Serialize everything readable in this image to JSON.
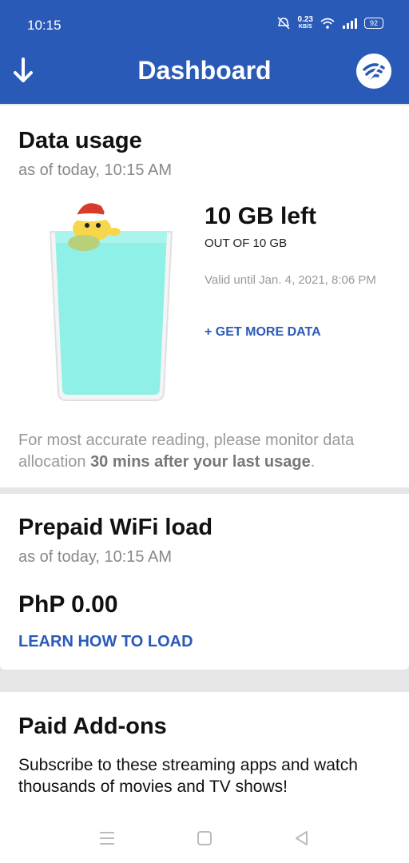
{
  "status_bar": {
    "time": "10:15",
    "net_speed_value": "0.23",
    "net_speed_unit": "KB/S",
    "battery": "92"
  },
  "header": {
    "title": "Dashboard",
    "background_color": "#2a5ab8"
  },
  "data_usage": {
    "title": "Data usage",
    "as_of": "as of today, 10:15 AM",
    "remaining": "10 GB left",
    "out_of": "OUT OF 10 GB",
    "valid_until": "Valid until Jan. 4, 2021, 8:06 PM",
    "get_more_label": "+ GET MORE DATA",
    "fill_level": 1.0,
    "note_prefix": "For most accurate reading, please monitor data allocation ",
    "note_bold": "30 mins after your last usage",
    "note_suffix": "."
  },
  "prepaid_load": {
    "title": "Prepaid WiFi load",
    "as_of": "as of today, 10:15 AM",
    "balance": "PhP 0.00",
    "learn_label": "LEARN HOW TO LOAD"
  },
  "paid_addons": {
    "title": "Paid Add-ons",
    "description": "Subscribe to these streaming apps and watch thousands of movies and TV shows!"
  },
  "icons": {
    "back": "arrow-down-icon",
    "wifi": "wifi-logo-icon",
    "nav_menu": "menu-icon",
    "nav_home": "square-icon",
    "nav_back": "triangle-back-icon"
  },
  "accent_color": "#2a5ab8",
  "water_color": "#8ff0e8"
}
